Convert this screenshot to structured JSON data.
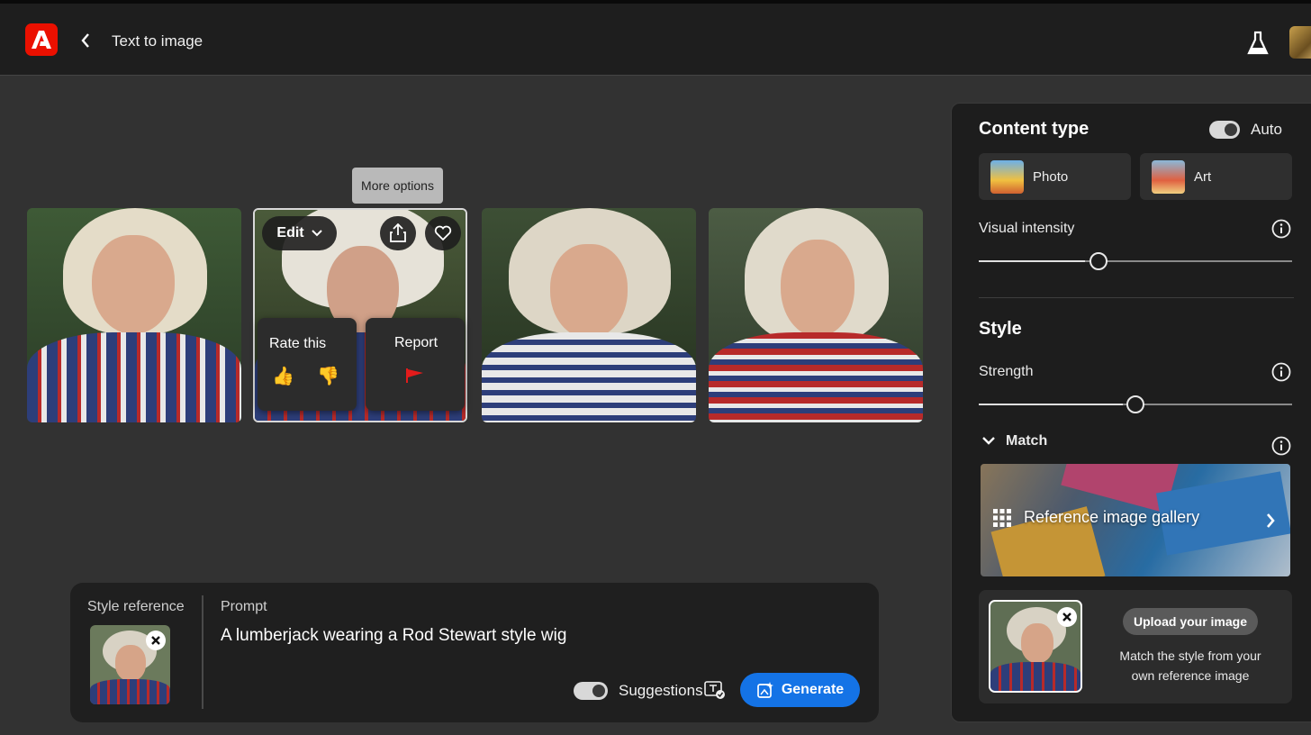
{
  "header": {
    "title": "Text to image"
  },
  "tooltip": "More options",
  "edit_menu": {
    "label": "Edit"
  },
  "rate": {
    "label": "Rate this",
    "up": "👍",
    "down": "👎"
  },
  "report": {
    "label": "Report"
  },
  "prompt_bar": {
    "style_reference_label": "Style reference",
    "prompt_label": "Prompt",
    "prompt_text": "A lumberjack wearing a Rod Stewart style wig",
    "suggestions_label": "Suggestions",
    "generate_label": "Generate"
  },
  "panel": {
    "content_type_title": "Content type",
    "auto_label": "Auto",
    "photo_label": "Photo",
    "art_label": "Art",
    "visual_intensity_label": "Visual intensity",
    "visual_intensity_value": 0.38,
    "style_title": "Style",
    "strength_label": "Strength",
    "strength_value": 0.5,
    "match_label": "Match",
    "gallery_label": "Reference image gallery",
    "upload_button": "Upload your image",
    "upload_desc_line1": "Match the style from your",
    "upload_desc_line2": "own reference image"
  },
  "colors": {
    "accent": "#1473e6",
    "logo": "#eb1000",
    "report_flag": "#e31b1b"
  }
}
